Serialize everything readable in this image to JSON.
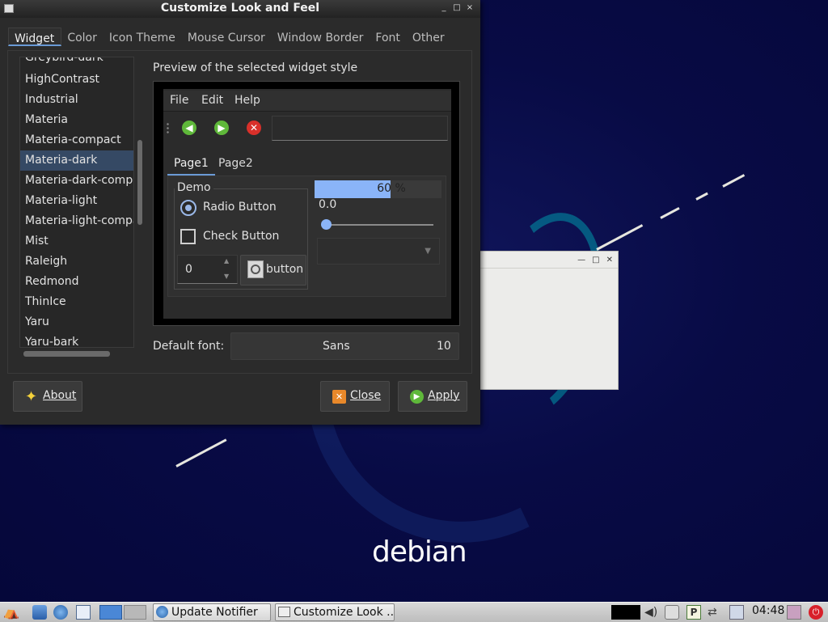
{
  "window": {
    "title": "Customize Look and Feel",
    "controls": [
      "_",
      "□",
      "×"
    ]
  },
  "tabs": [
    "Widget",
    "Color",
    "Icon Theme",
    "Mouse Cursor",
    "Window Border",
    "Font",
    "Other"
  ],
  "active_tab": "Widget",
  "theme_list": {
    "items": [
      "Greybird-dark",
      "HighContrast",
      "Industrial",
      "Materia",
      "Materia-compact",
      "Materia-dark",
      "Materia-dark-compa",
      "Materia-light",
      "Materia-light-compa",
      "Mist",
      "Raleigh",
      "Redmond",
      "ThinIce",
      "Yaru",
      "Yaru-bark"
    ],
    "selected": "Materia-dark"
  },
  "preview": {
    "heading": "Preview of the selected widget style",
    "menus": [
      "File",
      "Edit",
      "Help"
    ],
    "page_tabs": [
      "Page1",
      "Page2"
    ],
    "demo_legend": "Demo",
    "radio_label": "Radio Button",
    "check_label": "Check Button",
    "spin_value": "0",
    "button_label": "button",
    "progress_text": "60 %",
    "progress_fraction": 0.6,
    "slider_value": "0.0"
  },
  "font": {
    "label": "Default font:",
    "name": "Sans",
    "size": "10"
  },
  "buttons": {
    "about": "About",
    "close": "Close",
    "apply": "Apply"
  },
  "desktop": {
    "logo_text": "debian"
  },
  "taskbar": {
    "tasks": [
      "Update Notifier",
      "Customize Look ..."
    ],
    "clock": "04:48"
  },
  "colors": {
    "accent": "#8ab4f8",
    "selection": "#354964",
    "desktop_bg": "#070a3e"
  }
}
